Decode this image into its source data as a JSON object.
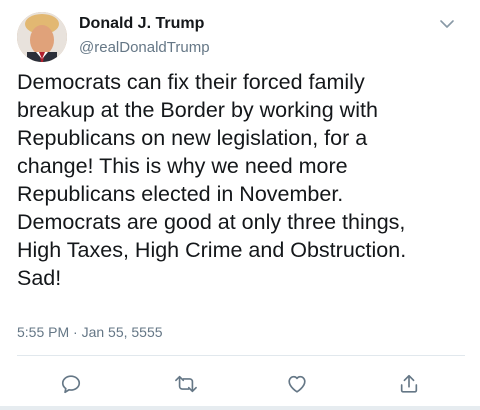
{
  "author": {
    "name": "Donald J. Trump",
    "handle": "@realDonaldTrump"
  },
  "tweet": {
    "text": "Democrats can fix their forced family\nbreakup at the Border by working with\nRepublicans on new legislation, for a\nchange! This is why we need more\nRepublicans elected in November.\nDemocrats are good at only three things,\nHigh Taxes, High Crime and Obstruction.\nSad!",
    "timestamp": "5:55 PM · Jan 55, 5555"
  },
  "icons": {
    "menu": "chevron-down-icon",
    "reply": "reply-icon",
    "retweet": "retweet-icon",
    "like": "heart-icon",
    "share": "share-icon"
  },
  "colors": {
    "text": "#14171a",
    "secondary": "#657786",
    "icon": "#657786",
    "divider": "#e1e8ed"
  }
}
